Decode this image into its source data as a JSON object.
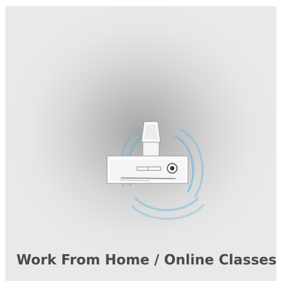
{
  "card": {
    "title": "Work From Home / Online Classes",
    "icon": "conference-camera-speaker-icon",
    "colors": {
      "background": "#e9e9e9",
      "glow": "#a6a6a6",
      "title": "#4a4a4a",
      "waves": "#5fb3e0"
    }
  }
}
